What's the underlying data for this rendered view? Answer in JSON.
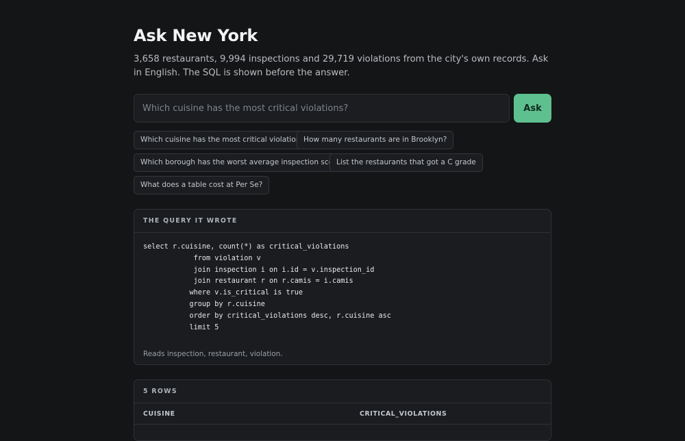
{
  "header": {
    "title": "Ask New York",
    "subtitle": "3,658 restaurants, 9,994 inspections and 29,719 violations from the city's own records. Ask in English. The SQL is shown before the answer."
  },
  "search": {
    "placeholder": "Which cuisine has the most critical violations?",
    "value": "",
    "ask_label": "Ask"
  },
  "suggestions": [
    "Which cuisine has the most critical violations?",
    "How many restaurants are in Brooklyn?",
    "Which borough has the worst average inspection score?",
    "List the restaurants that got a C grade",
    "What does a table cost at Per Se?"
  ],
  "query_panel": {
    "heading": "THE QUERY IT WROTE",
    "sql": "select r.cuisine, count(*) as critical_violations\n            from violation v\n            join inspection i on i.id = v.inspection_id\n            join restaurant r on r.camis = i.camis\n           where v.is_critical is true\n           group by r.cuisine\n           order by critical_violations desc, r.cuisine asc\n           limit 5",
    "reads_note": "Reads inspection, restaurant, violation."
  },
  "results_panel": {
    "heading": "5 ROWS",
    "columns": [
      "CUISINE",
      "CRITICAL_VIOLATIONS"
    ]
  },
  "colors": {
    "background": "#141516",
    "panel": "#1a1c1f",
    "border": "#2e3135",
    "accent": "#5fc08f"
  }
}
